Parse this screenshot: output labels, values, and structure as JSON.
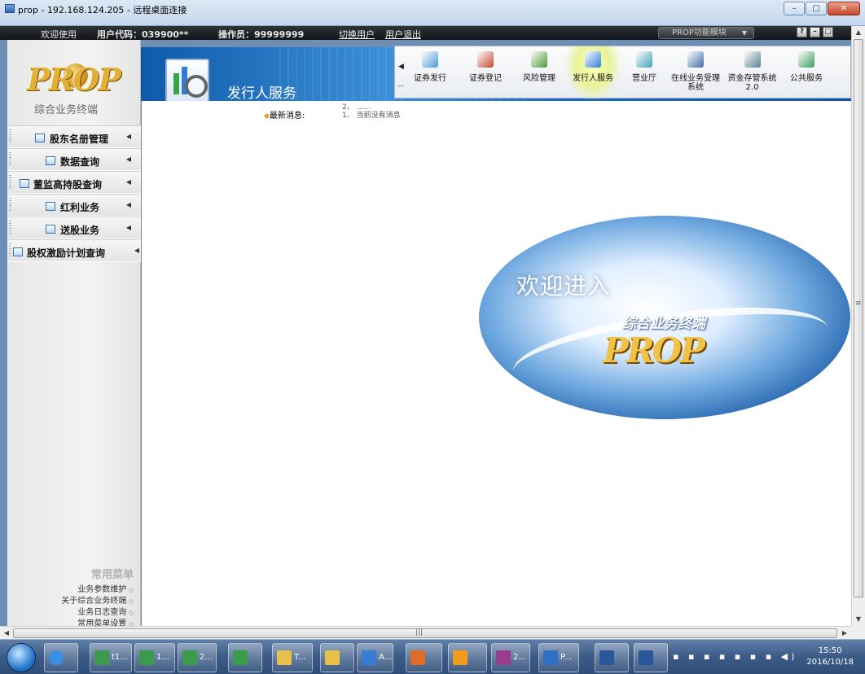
{
  "window": {
    "title": "prop - 192.168.124.205 - 远程桌面连接",
    "buttons": [
      "–",
      "□",
      "✕"
    ]
  },
  "userbar": {
    "welcome": "欢迎使用",
    "user_code_label": "用户代码：039900**",
    "operator_label": "操作员：99999999",
    "switch_user": "切换用户",
    "logout": "用户退出",
    "module_select": "PROP功能模块",
    "icons": [
      "?",
      "–",
      "□"
    ]
  },
  "sidebar": {
    "logo": "PROP",
    "subtitle": "综合业务终端",
    "items": [
      {
        "label": "股东名册管理"
      },
      {
        "label": "数据查询"
      },
      {
        "label": "董监高持股查询"
      },
      {
        "label": "红利业务"
      },
      {
        "label": "送股业务"
      },
      {
        "label": "股权激励计划查询"
      }
    ],
    "common_menu": {
      "title": "常用菜单",
      "links": [
        "业务参数维护",
        "关于综合业务终端",
        "业务日志查询",
        "常用菜单设置"
      ]
    }
  },
  "header": {
    "title": "发行人服务"
  },
  "toolbar": {
    "tools": [
      {
        "label": "证券发行",
        "icon": "chart-up-icon",
        "color": "#4f9ad6"
      },
      {
        "label": "证券登记",
        "icon": "pen-icon",
        "color": "#c44a2e"
      },
      {
        "label": "风险管理",
        "icon": "document-chart-icon",
        "color": "#4a9a34"
      },
      {
        "label": "发行人服务",
        "icon": "chart-magnifier-icon",
        "color": "#2d7dd2"
      },
      {
        "label": "营业厅",
        "icon": "hall-icon",
        "color": "#3fa3b4"
      },
      {
        "label": "在线业务受理系统",
        "icon": "people-icon",
        "color": "#3d6ea8"
      },
      {
        "label": "资金存管系统2.0",
        "icon": "vault-icon",
        "color": "#5b7f94"
      },
      {
        "label": "公共服务",
        "icon": "globe-icon",
        "color": "#3b9e5a"
      }
    ],
    "active_index": 3
  },
  "content": {
    "news_label": "最新消息:",
    "news_lines": [
      "2、 ……",
      "1、 当前没有消息"
    ],
    "splash_welcome": "欢迎进入",
    "splash_subtitle": "综合业务终端",
    "splash_logo": "PROP"
  },
  "taskbar": {
    "items": [
      {
        "label": "t1...",
        "icon": "excel-icon"
      },
      {
        "label": "1...",
        "icon": "excel-icon"
      },
      {
        "label": "2...",
        "icon": "excel-icon"
      },
      {
        "label": "",
        "icon": "excel-icon"
      },
      {
        "label": "T...",
        "icon": "folder-icon"
      },
      {
        "label": "",
        "icon": "folder-icon"
      },
      {
        "label": "A...",
        "icon": "app-icon"
      },
      {
        "label": "",
        "icon": "office-icon"
      },
      {
        "label": "",
        "icon": "app-orange-icon"
      },
      {
        "label": "2...",
        "icon": "archive-icon"
      },
      {
        "label": "P...",
        "icon": "remote-desktop-icon"
      },
      {
        "label": "",
        "icon": "word-icon"
      },
      {
        "label": "",
        "icon": "word-icon"
      }
    ],
    "time": "15:50",
    "date": "2016/10/18"
  }
}
